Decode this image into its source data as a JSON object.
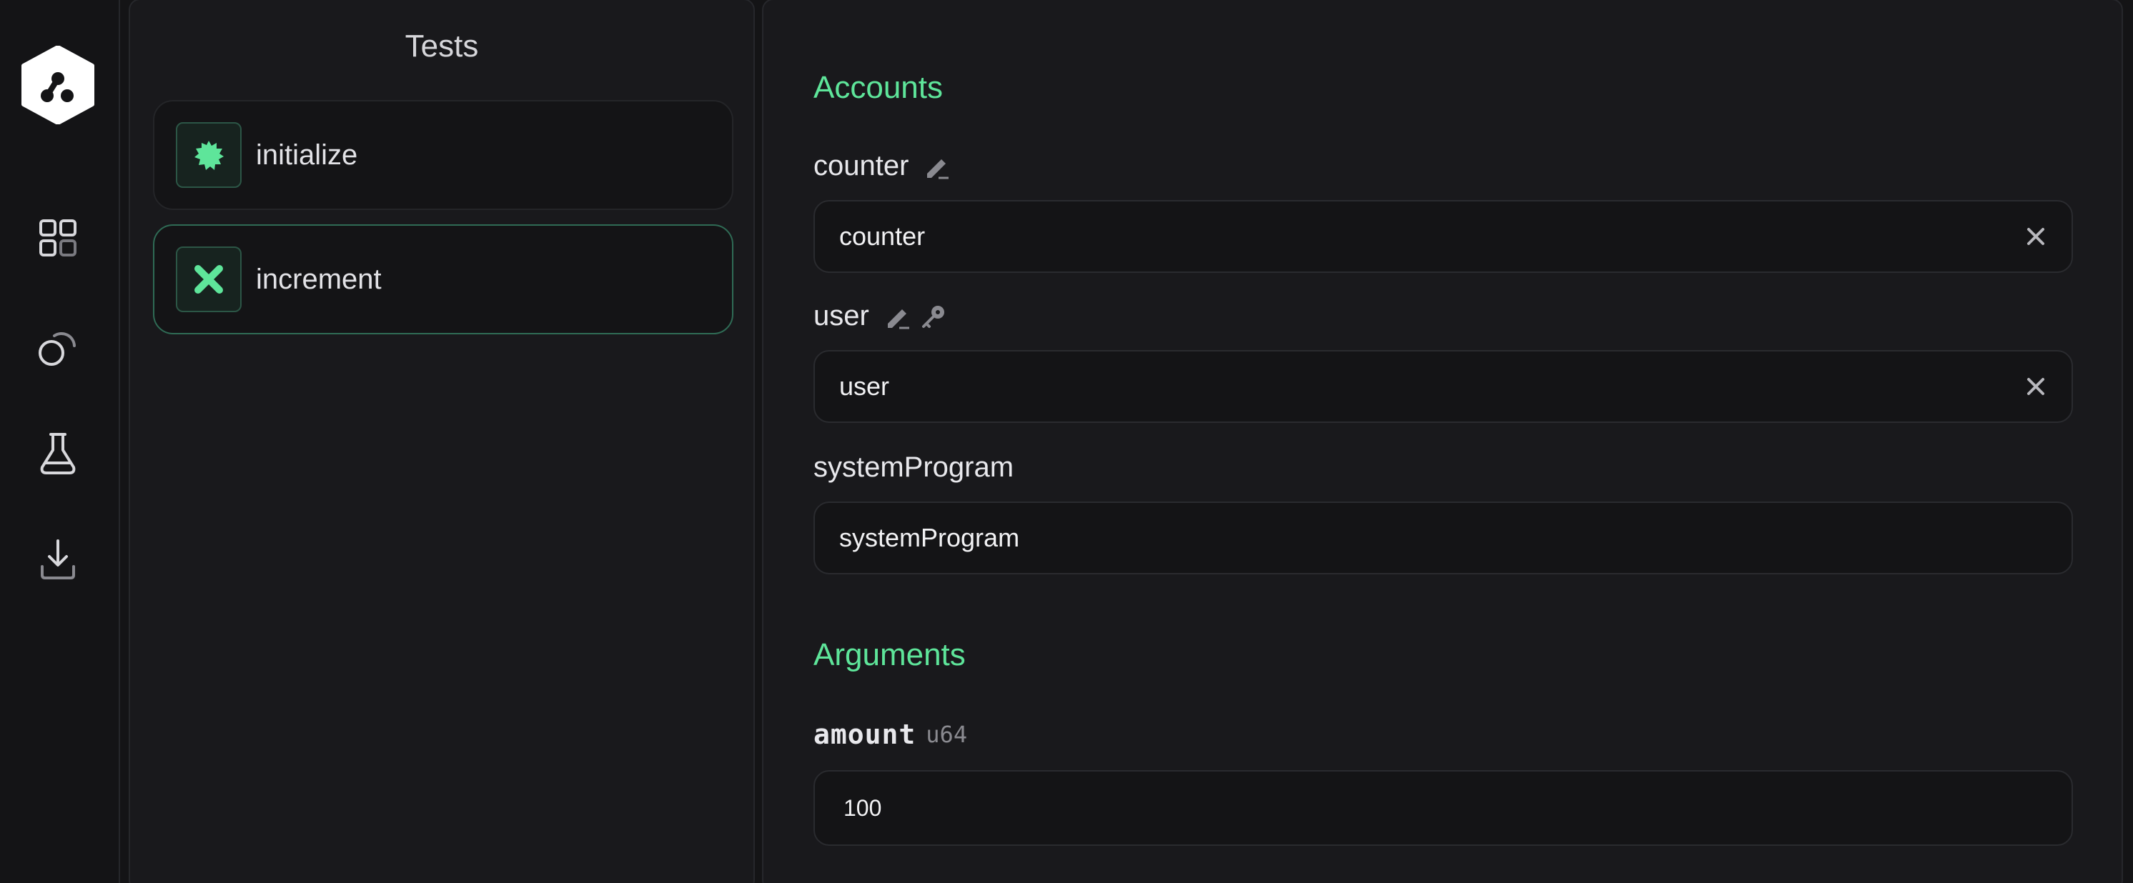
{
  "tests": {
    "title": "Tests",
    "items": [
      {
        "label": "initialize",
        "icon": "gear-badge-icon",
        "active": false
      },
      {
        "label": "increment",
        "icon": "x-cross-icon",
        "active": true
      }
    ]
  },
  "accounts": {
    "title": "Accounts",
    "fields": [
      {
        "label": "counter",
        "value": "counter",
        "mutable": true,
        "signer": false,
        "clearable": true
      },
      {
        "label": "user",
        "value": "user",
        "mutable": true,
        "signer": true,
        "clearable": true
      },
      {
        "label": "systemProgram",
        "value": "systemProgram",
        "mutable": false,
        "signer": false,
        "clearable": false
      }
    ]
  },
  "arguments": {
    "title": "Arguments",
    "fields": [
      {
        "label": "amount",
        "type": "u64",
        "value": "100"
      }
    ]
  },
  "colors": {
    "accent": "#5ee59a",
    "background": "#141416",
    "panel": "#19191c",
    "active_border": "#2f6b55"
  },
  "nav": {
    "items": [
      "grid-icon",
      "shapes-icon",
      "flask-icon",
      "download-icon"
    ]
  }
}
